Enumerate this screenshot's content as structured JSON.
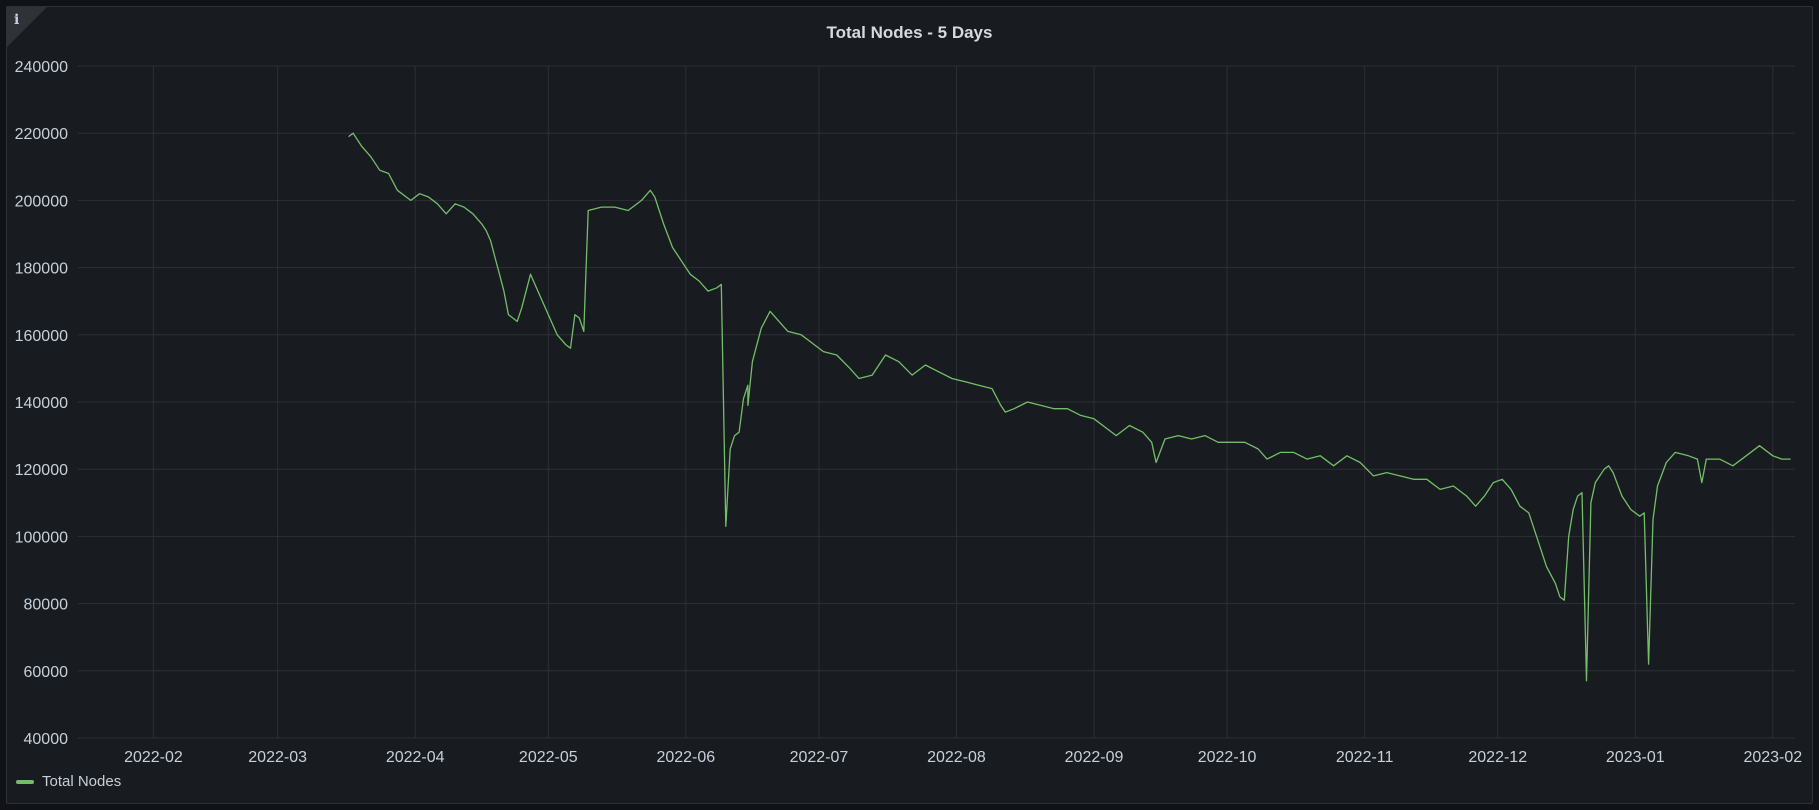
{
  "panel": {
    "title": "Total Nodes - 5 Days",
    "info_icon": "info-icon"
  },
  "colors": {
    "series": "#73bf69",
    "grid": "#2c3036",
    "text": "#c7d0d9"
  },
  "chart_data": {
    "type": "line",
    "title": "Total Nodes - 5 Days",
    "xlabel": "",
    "ylabel": "",
    "grid": true,
    "legend_position": "bottom-left",
    "ylim": [
      40000,
      240000
    ],
    "xlim": [
      "2022-01-15",
      "2023-02-06"
    ],
    "y_ticks": [
      "240000",
      "220000",
      "200000",
      "180000",
      "160000",
      "140000",
      "120000",
      "100000",
      "80000",
      "60000",
      "40000"
    ],
    "x_ticks": [
      {
        "label": "2022-02",
        "date": "2022-02-01"
      },
      {
        "label": "2022-03",
        "date": "2022-03-01"
      },
      {
        "label": "2022-04",
        "date": "2022-04-01"
      },
      {
        "label": "2022-05",
        "date": "2022-05-01"
      },
      {
        "label": "2022-06",
        "date": "2022-06-01"
      },
      {
        "label": "2022-07",
        "date": "2022-07-01"
      },
      {
        "label": "2022-08",
        "date": "2022-08-01"
      },
      {
        "label": "2022-09",
        "date": "2022-09-01"
      },
      {
        "label": "2022-10",
        "date": "2022-10-01"
      },
      {
        "label": "2022-11",
        "date": "2022-11-01"
      },
      {
        "label": "2022-12",
        "date": "2022-12-01"
      },
      {
        "label": "2023-01",
        "date": "2023-01-01"
      },
      {
        "label": "2023-02",
        "date": "2023-02-01"
      }
    ],
    "series": [
      {
        "name": "Total Nodes",
        "points": [
          [
            "2022-03-17",
            219000
          ],
          [
            "2022-03-18",
            220000
          ],
          [
            "2022-03-20",
            216000
          ],
          [
            "2022-03-22",
            213000
          ],
          [
            "2022-03-24",
            209000
          ],
          [
            "2022-03-26",
            208000
          ],
          [
            "2022-03-28",
            203000
          ],
          [
            "2022-03-31",
            200000
          ],
          [
            "2022-04-02",
            202000
          ],
          [
            "2022-04-04",
            201000
          ],
          [
            "2022-04-06",
            199000
          ],
          [
            "2022-04-08",
            196000
          ],
          [
            "2022-04-10",
            199000
          ],
          [
            "2022-04-12",
            198000
          ],
          [
            "2022-04-14",
            196000
          ],
          [
            "2022-04-16",
            193000
          ],
          [
            "2022-04-17",
            191000
          ],
          [
            "2022-04-18",
            188000
          ],
          [
            "2022-04-19",
            183000
          ],
          [
            "2022-04-20",
            178000
          ],
          [
            "2022-04-21",
            173000
          ],
          [
            "2022-04-22",
            166000
          ],
          [
            "2022-04-23",
            165000
          ],
          [
            "2022-04-24",
            164000
          ],
          [
            "2022-04-25",
            168000
          ],
          [
            "2022-04-27",
            178000
          ],
          [
            "2022-04-29",
            172000
          ],
          [
            "2022-05-01",
            166000
          ],
          [
            "2022-05-03",
            160000
          ],
          [
            "2022-05-05",
            157000
          ],
          [
            "2022-05-06",
            156000
          ],
          [
            "2022-05-07",
            166000
          ],
          [
            "2022-05-08",
            165000
          ],
          [
            "2022-05-09",
            161000
          ],
          [
            "2022-05-10",
            197000
          ],
          [
            "2022-05-13",
            198000
          ],
          [
            "2022-05-16",
            198000
          ],
          [
            "2022-05-19",
            197000
          ],
          [
            "2022-05-22",
            200000
          ],
          [
            "2022-05-24",
            203000
          ],
          [
            "2022-05-25",
            201000
          ],
          [
            "2022-05-27",
            193000
          ],
          [
            "2022-05-29",
            186000
          ],
          [
            "2022-05-31",
            182000
          ],
          [
            "2022-06-02",
            178000
          ],
          [
            "2022-06-04",
            176000
          ],
          [
            "2022-06-06",
            173000
          ],
          [
            "2022-06-08",
            174000
          ],
          [
            "2022-06-09",
            175000
          ],
          [
            "2022-06-10",
            103000
          ],
          [
            "2022-06-11",
            126000
          ],
          [
            "2022-06-12",
            130000
          ],
          [
            "2022-06-13",
            131000
          ],
          [
            "2022-06-14",
            141000
          ],
          [
            "2022-06-15",
            145000
          ],
          [
            "2022-06-15",
            139000
          ],
          [
            "2022-06-16",
            152000
          ],
          [
            "2022-06-18",
            162000
          ],
          [
            "2022-06-20",
            167000
          ],
          [
            "2022-06-22",
            164000
          ],
          [
            "2022-06-24",
            161000
          ],
          [
            "2022-06-27",
            160000
          ],
          [
            "2022-06-29",
            158000
          ],
          [
            "2022-07-02",
            155000
          ],
          [
            "2022-07-05",
            154000
          ],
          [
            "2022-07-08",
            150000
          ],
          [
            "2022-07-10",
            147000
          ],
          [
            "2022-07-13",
            148000
          ],
          [
            "2022-07-16",
            154000
          ],
          [
            "2022-07-19",
            152000
          ],
          [
            "2022-07-22",
            148000
          ],
          [
            "2022-07-25",
            151000
          ],
          [
            "2022-07-28",
            149000
          ],
          [
            "2022-07-31",
            147000
          ],
          [
            "2022-08-03",
            146000
          ],
          [
            "2022-08-06",
            145000
          ],
          [
            "2022-08-09",
            144000
          ],
          [
            "2022-08-11",
            139000
          ],
          [
            "2022-08-12",
            137000
          ],
          [
            "2022-08-14",
            138000
          ],
          [
            "2022-08-17",
            140000
          ],
          [
            "2022-08-20",
            139000
          ],
          [
            "2022-08-23",
            138000
          ],
          [
            "2022-08-26",
            138000
          ],
          [
            "2022-08-29",
            136000
          ],
          [
            "2022-09-01",
            135000
          ],
          [
            "2022-09-04",
            132000
          ],
          [
            "2022-09-06",
            130000
          ],
          [
            "2022-09-09",
            133000
          ],
          [
            "2022-09-12",
            131000
          ],
          [
            "2022-09-14",
            128000
          ],
          [
            "2022-09-15",
            122000
          ],
          [
            "2022-09-17",
            129000
          ],
          [
            "2022-09-20",
            130000
          ],
          [
            "2022-09-23",
            129000
          ],
          [
            "2022-09-26",
            130000
          ],
          [
            "2022-09-29",
            128000
          ],
          [
            "2022-10-02",
            128000
          ],
          [
            "2022-10-05",
            128000
          ],
          [
            "2022-10-08",
            126000
          ],
          [
            "2022-10-10",
            123000
          ],
          [
            "2022-10-13",
            125000
          ],
          [
            "2022-10-16",
            125000
          ],
          [
            "2022-10-19",
            123000
          ],
          [
            "2022-10-22",
            124000
          ],
          [
            "2022-10-25",
            121000
          ],
          [
            "2022-10-28",
            124000
          ],
          [
            "2022-10-31",
            122000
          ],
          [
            "2022-11-03",
            118000
          ],
          [
            "2022-11-06",
            119000
          ],
          [
            "2022-11-09",
            118000
          ],
          [
            "2022-11-12",
            117000
          ],
          [
            "2022-11-15",
            117000
          ],
          [
            "2022-11-18",
            114000
          ],
          [
            "2022-11-21",
            115000
          ],
          [
            "2022-11-24",
            112000
          ],
          [
            "2022-11-26",
            109000
          ],
          [
            "2022-11-28",
            112000
          ],
          [
            "2022-11-30",
            116000
          ],
          [
            "2022-12-02",
            117000
          ],
          [
            "2022-12-04",
            114000
          ],
          [
            "2022-12-06",
            109000
          ],
          [
            "2022-12-08",
            107000
          ],
          [
            "2022-12-10",
            99000
          ],
          [
            "2022-12-12",
            91000
          ],
          [
            "2022-12-14",
            86000
          ],
          [
            "2022-12-15",
            82000
          ],
          [
            "2022-12-16",
            81000
          ],
          [
            "2022-12-17",
            100000
          ],
          [
            "2022-12-18",
            108000
          ],
          [
            "2022-12-19",
            112000
          ],
          [
            "2022-12-20",
            113000
          ],
          [
            "2022-12-21",
            57000
          ],
          [
            "2022-12-22",
            110000
          ],
          [
            "2022-12-23",
            116000
          ],
          [
            "2022-12-25",
            120000
          ],
          [
            "2022-12-26",
            121000
          ],
          [
            "2022-12-27",
            119000
          ],
          [
            "2022-12-29",
            112000
          ],
          [
            "2022-12-31",
            108000
          ],
          [
            "2023-01-02",
            106000
          ],
          [
            "2023-01-03",
            107000
          ],
          [
            "2023-01-04",
            62000
          ],
          [
            "2023-01-05",
            105000
          ],
          [
            "2023-01-06",
            115000
          ],
          [
            "2023-01-08",
            122000
          ],
          [
            "2023-01-10",
            125000
          ],
          [
            "2023-01-13",
            124000
          ],
          [
            "2023-01-15",
            123000
          ],
          [
            "2023-01-16",
            116000
          ],
          [
            "2023-01-17",
            123000
          ],
          [
            "2023-01-20",
            123000
          ],
          [
            "2023-01-23",
            121000
          ],
          [
            "2023-01-26",
            124000
          ],
          [
            "2023-01-29",
            127000
          ],
          [
            "2023-02-01",
            124000
          ],
          [
            "2023-02-03",
            123000
          ],
          [
            "2023-02-05",
            123000
          ]
        ]
      }
    ]
  }
}
